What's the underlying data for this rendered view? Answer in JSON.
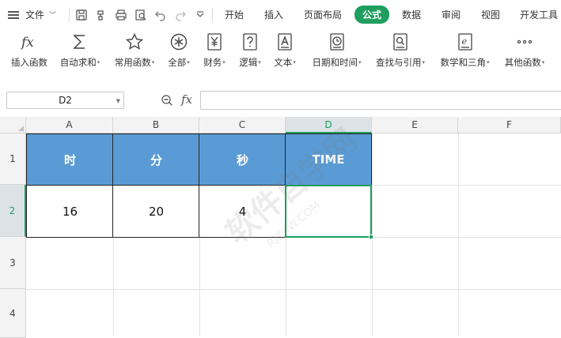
{
  "menubar": {
    "file_label": "文件",
    "tabs": [
      {
        "label": "开始"
      },
      {
        "label": "插入"
      },
      {
        "label": "页面布局"
      },
      {
        "label": "公式",
        "active": true
      },
      {
        "label": "数据"
      },
      {
        "label": "审阅"
      },
      {
        "label": "视图"
      },
      {
        "label": "开发工具"
      }
    ]
  },
  "ribbon": {
    "items": [
      {
        "label": "插入函数",
        "icon": "fx-icon",
        "dropdown": false
      },
      {
        "label": "自动求和",
        "icon": "sigma-icon",
        "dropdown": true
      },
      {
        "label": "常用函数",
        "icon": "star-icon",
        "dropdown": true
      },
      {
        "label": "全部",
        "icon": "asterisk-icon",
        "dropdown": true
      },
      {
        "label": "财务",
        "icon": "yen-icon",
        "dropdown": true
      },
      {
        "label": "逻辑",
        "icon": "question-icon",
        "dropdown": true
      },
      {
        "label": "文本",
        "icon": "text-a-icon",
        "dropdown": true
      },
      {
        "label": "日期和时间",
        "icon": "clock-icon",
        "dropdown": true
      },
      {
        "label": "查找与引用",
        "icon": "search-doc-icon",
        "dropdown": true
      },
      {
        "label": "数学和三角",
        "icon": "math-book-icon",
        "dropdown": true
      },
      {
        "label": "其他函数",
        "icon": "more-dots-icon",
        "dropdown": true
      }
    ],
    "dropdown_glyph": "▾"
  },
  "formula_bar": {
    "name_box": "D2",
    "fx_label": "fx",
    "formula_value": ""
  },
  "grid": {
    "columns": [
      "A",
      "B",
      "C",
      "D",
      "E",
      "F"
    ],
    "rows": [
      "1",
      "2",
      "3",
      "4"
    ],
    "selected_column": "D",
    "selected_row": "2",
    "header_row": [
      "时",
      "分",
      "秒",
      "TIME"
    ],
    "data_row": [
      "16",
      "20",
      "4",
      ""
    ]
  },
  "colors": {
    "accent": "#1f9e5f",
    "header_fill": "#5b9bd5"
  },
  "watermark": {
    "text_cn": "软件自学网",
    "text_en": "RJZXW.COM"
  }
}
